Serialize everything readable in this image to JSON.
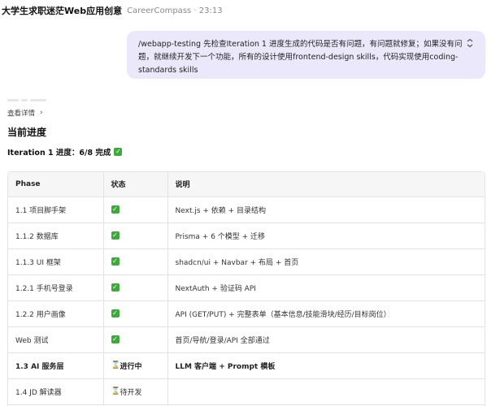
{
  "header": {
    "title": "大学生求职迷茫Web应用创意",
    "subtitle": "CareerCompass · 23:13"
  },
  "message": {
    "text": "/webapp-testing 先检查Iteration 1 进度生成的代码是否有问题，有问题就修复；如果没有问题，就继续开发下一个功能，所有的设计使用frontend-design skills，代码实现使用coding-standards skills",
    "collapse_icon": "chevron-collapse-icon"
  },
  "details": {
    "label": "查看详情",
    "chevron": "›"
  },
  "progress": {
    "heading": "当前进度",
    "iteration_line": "Iteration 1 进度：6/8 完成",
    "iteration_status_icon": "check-icon"
  },
  "table": {
    "headers": [
      "Phase",
      "状态",
      "说明"
    ],
    "rows": [
      {
        "phase": "1.1 项目脚手架",
        "status_icon": "check",
        "status_text": "",
        "desc": "Next.js + 依赖 + 目录结构",
        "bold": false
      },
      {
        "phase": "1.1.2 数据库",
        "status_icon": "check",
        "status_text": "",
        "desc": "Prisma + 6 个模型 + 迁移",
        "bold": false
      },
      {
        "phase": "1.1.3 UI 框架",
        "status_icon": "check",
        "status_text": "",
        "desc": "shadcn/ui + Navbar + 布局 + 首页",
        "bold": false
      },
      {
        "phase": "1.2.1 手机号登录",
        "status_icon": "check",
        "status_text": "",
        "desc": "NextAuth + 验证码 API",
        "bold": false
      },
      {
        "phase": "1.2.2 用户画像",
        "status_icon": "check",
        "status_text": "",
        "desc": "API (GET/PUT) + 完整表单（基本信息/技能滑块/经历/目标岗位）",
        "bold": false
      },
      {
        "phase": "Web 测试",
        "status_icon": "check",
        "status_text": "",
        "desc": "首页/导航/登录/API 全部通过",
        "bold": false
      },
      {
        "phase": "1.3 AI 服务层",
        "status_icon": "hourglass",
        "status_text": "进行中",
        "desc": "LLM 客户端 + Prompt 模板",
        "bold": true
      },
      {
        "phase": "1.4 JD 解读器",
        "status_icon": "hourglass",
        "status_text": "待开发",
        "desc": "",
        "bold": false
      }
    ]
  },
  "colors": {
    "bubble_bg": "#ebe8fb",
    "check_green": "#3daa3a",
    "hourglass": "#b5651d"
  }
}
